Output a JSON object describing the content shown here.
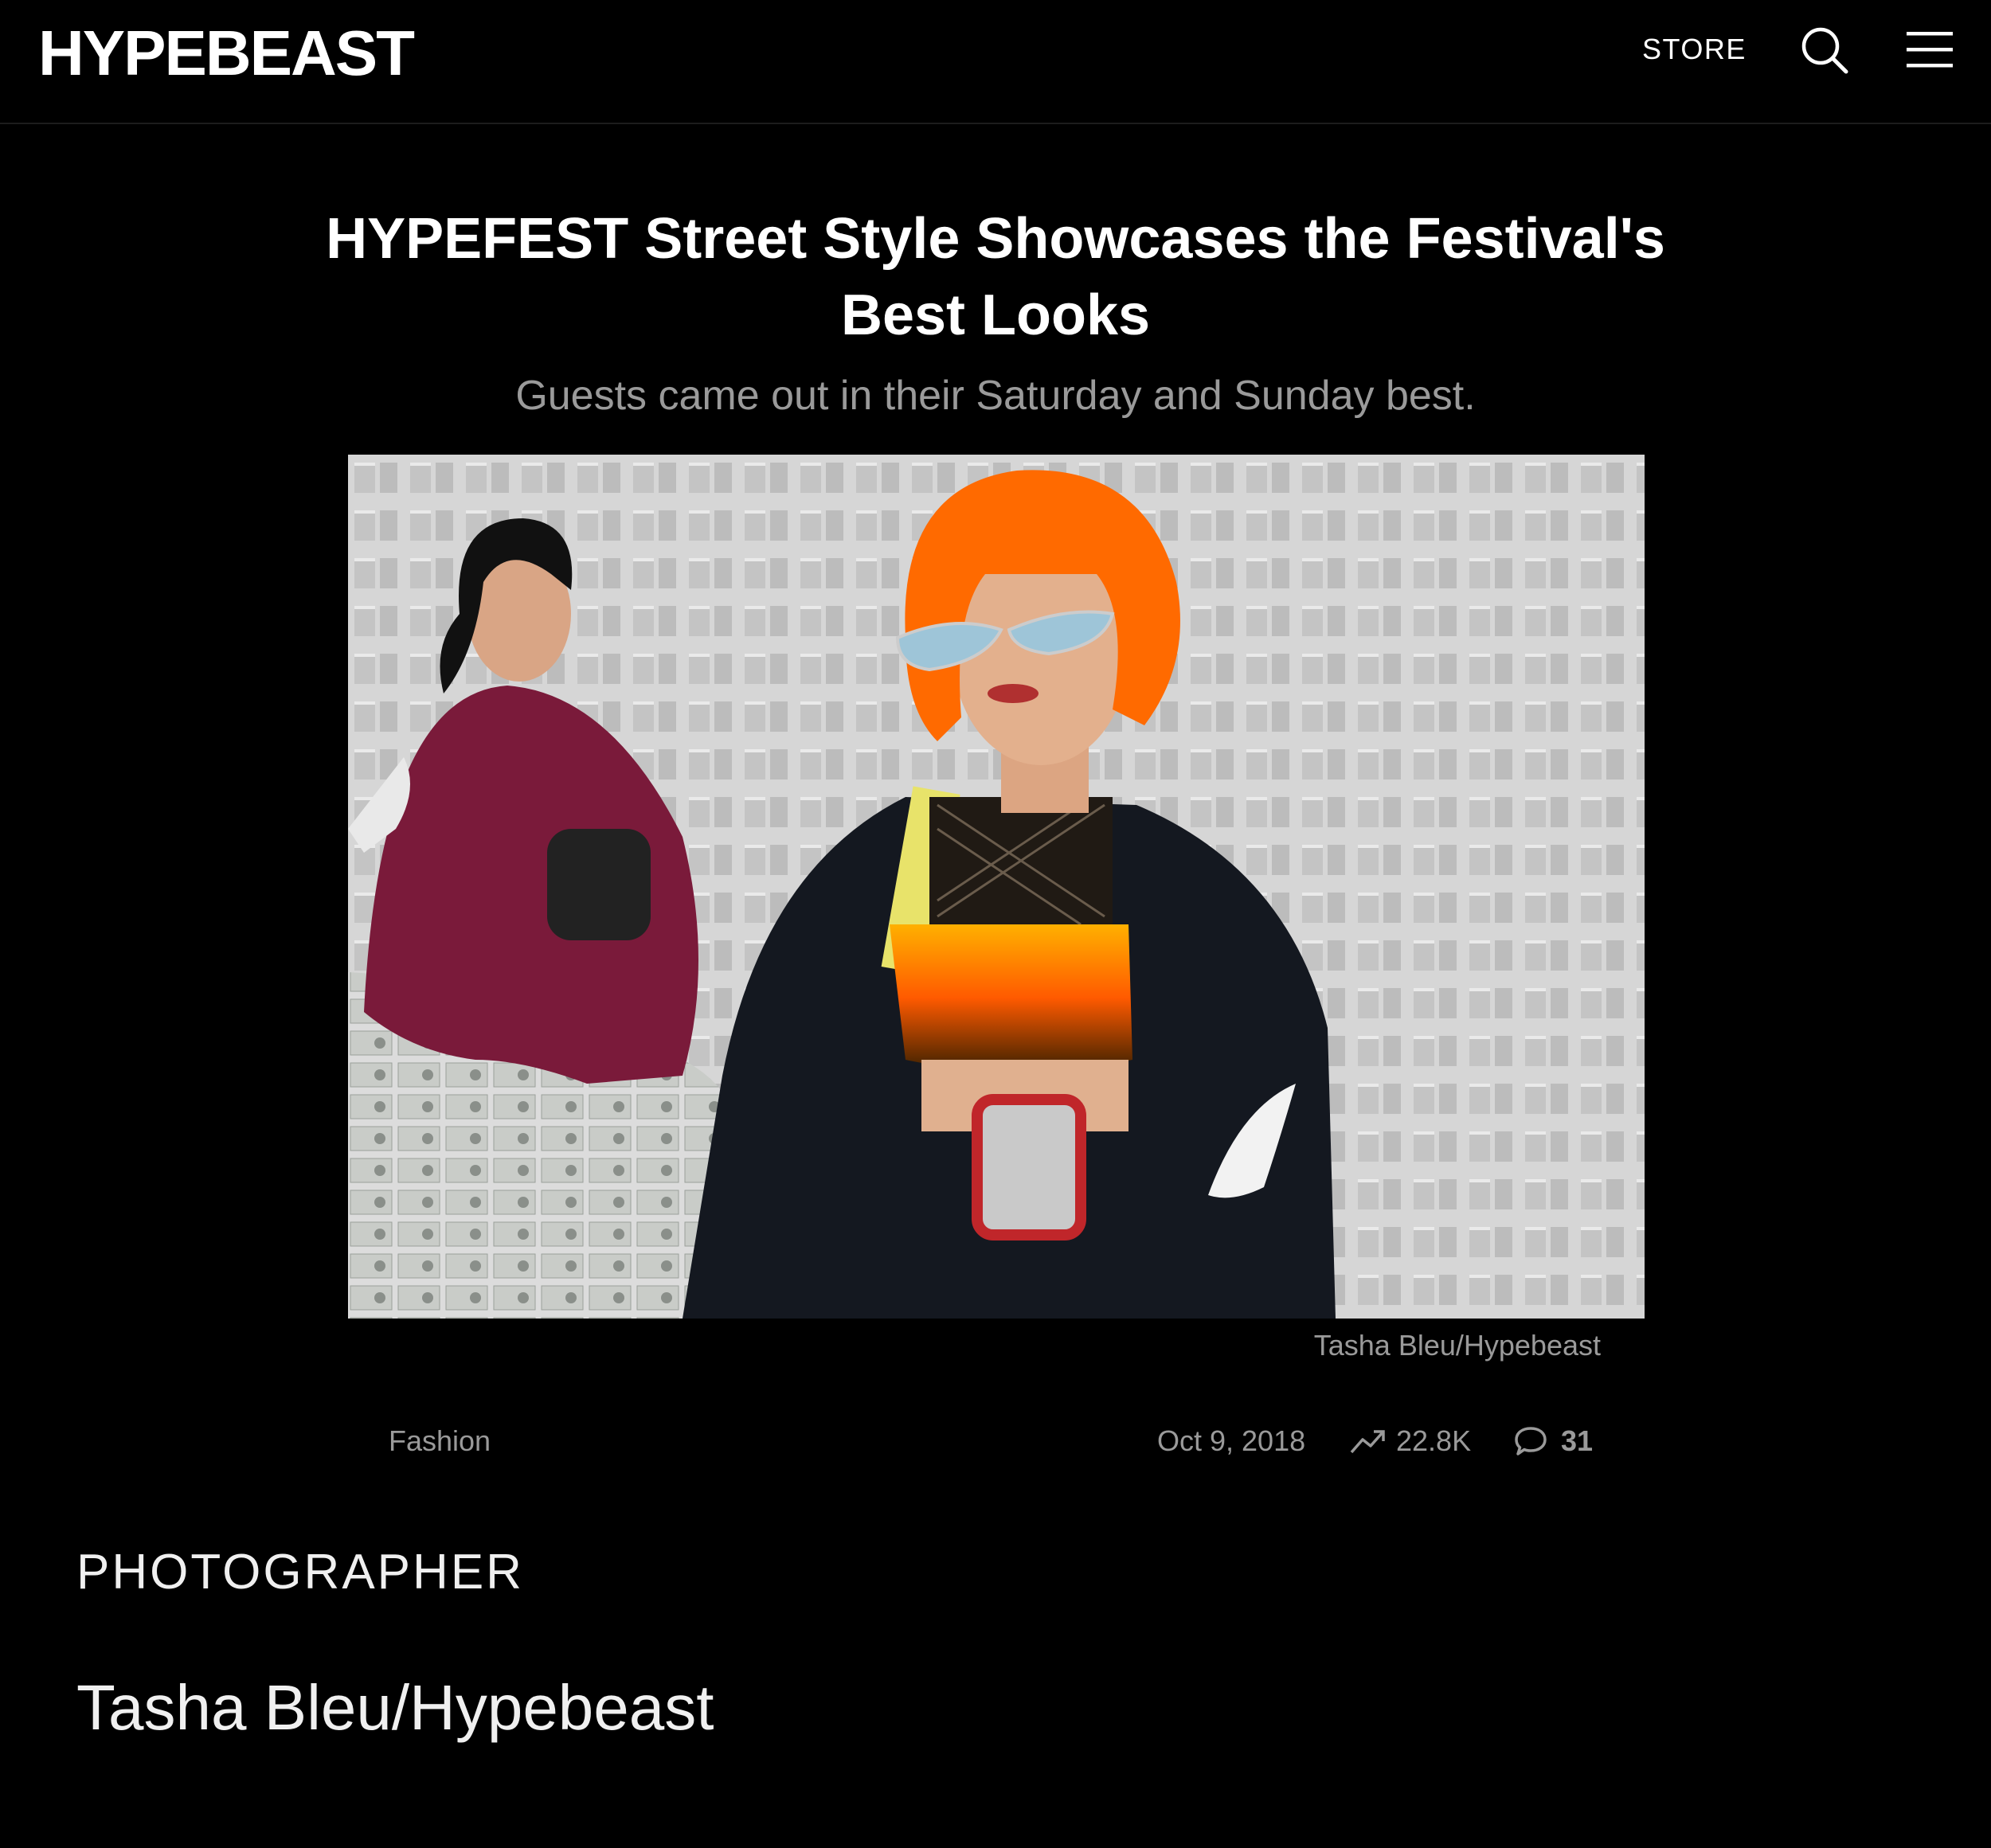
{
  "header": {
    "logo": "HYPEBEAST",
    "store_label": "STORE",
    "search_icon": "search-icon",
    "menu_icon": "hamburger-menu-icon"
  },
  "article": {
    "title": "HYPEFEST Street Style Showcases the Festival's Best Looks",
    "subtitle": "Guests came out in their Saturday and Sunday best.",
    "image_caption": "Tasha Bleu/Hypebeast",
    "category": "Fashion",
    "date": "Oct 9, 2018",
    "views": "22.8K",
    "comments": "31",
    "trend_icon": "trending-up-icon",
    "comment_icon": "comment-bubble-icon"
  },
  "credits": {
    "label": "PHOTOGRAPHER",
    "name": "Tasha Bleu/Hypebeast"
  },
  "colors": {
    "background": "#000000",
    "text_primary": "#ffffff",
    "text_secondary": "#9a9a9a",
    "hair_orange": "#ff6a00"
  }
}
